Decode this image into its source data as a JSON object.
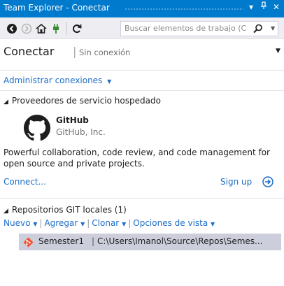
{
  "window": {
    "title": "Team Explorer - Conectar",
    "dropdown_glyph": "▾",
    "pin_glyph": "⊥",
    "close_glyph": "✕"
  },
  "toolbar": {
    "search_placeholder": "Buscar elementos de trabajo (C",
    "icons": [
      "back-icon",
      "forward-icon",
      "home-icon",
      "connect-plug-icon",
      "refresh-icon",
      "search-icon",
      "search-dropdown-icon"
    ]
  },
  "header": {
    "title": "Conectar",
    "separator": "|",
    "subtitle": "Sin conexión"
  },
  "manage_connections": "Administrar conexiones",
  "hosted_section": {
    "title": "Proveedores de servicio hospedado",
    "provider_name": "GitHub",
    "provider_company": "GitHub, Inc.",
    "description": "Powerful collaboration, code review, and code management for open source and private projects.",
    "connect_label": "Connect...",
    "signup_label": "Sign up"
  },
  "local_repos": {
    "title": "Repositorios GIT locales (1)",
    "actions": [
      "Nuevo",
      "Agregar",
      "Clonar",
      "Opciones de vista"
    ],
    "separator": "|",
    "repos": [
      {
        "name": "Semester1",
        "path": "C:\\Users\\Imanol\\Source\\Repos\\Semes..."
      }
    ]
  },
  "colors": {
    "titlebar": "#007acc",
    "toolbar": "#eeeef2",
    "link": "#1e6fc8",
    "selected_row": "#cccedb",
    "git_icon": "#f05133"
  }
}
